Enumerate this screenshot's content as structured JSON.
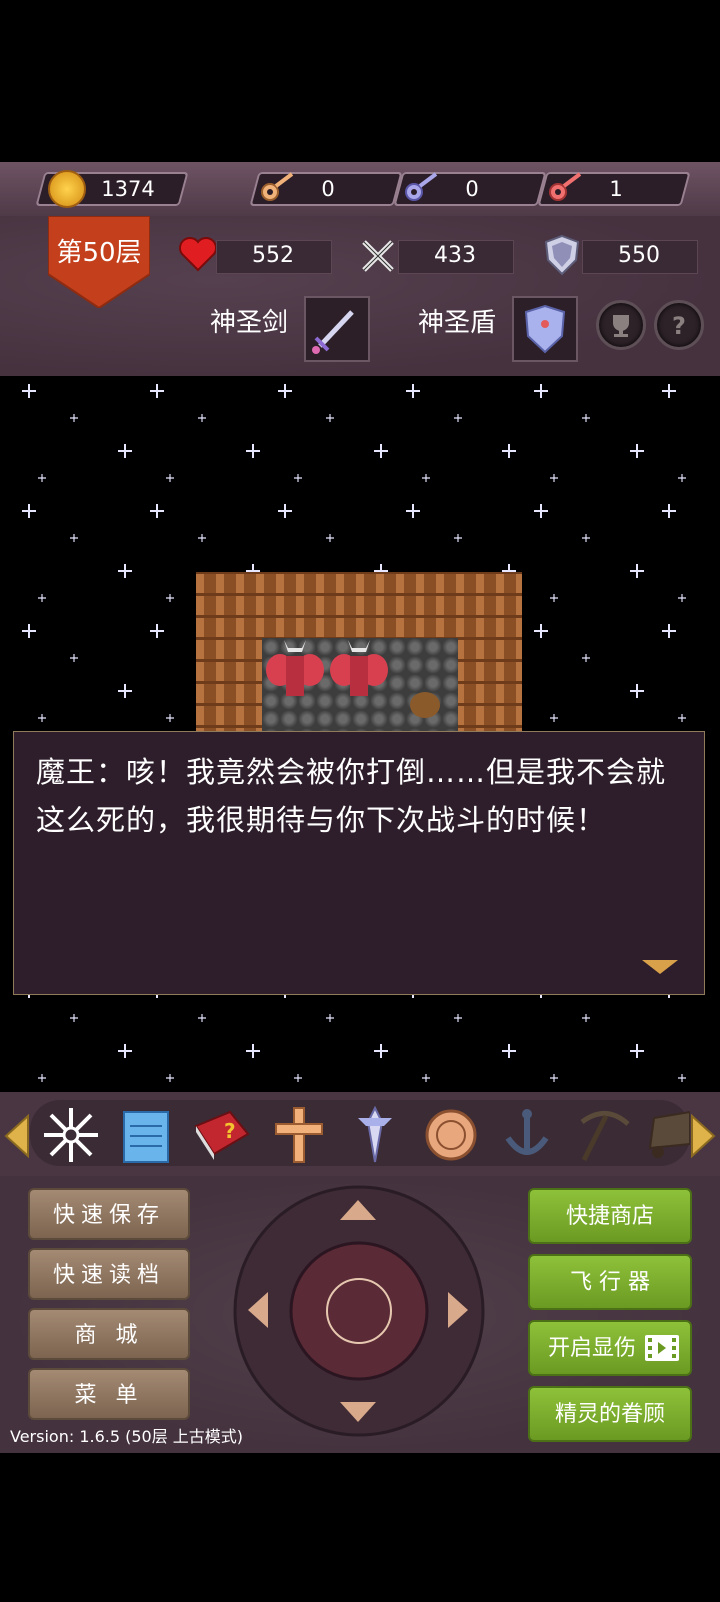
{
  "resources": {
    "gold": "1374",
    "yellow_keys": "0",
    "blue_keys": "0",
    "red_keys": "1"
  },
  "floor": {
    "label": "第50层"
  },
  "stats": {
    "hp": "552",
    "attack": "433",
    "defense": "550"
  },
  "equipment": {
    "weapon_label": "神圣剑",
    "armor_label": "神圣盾"
  },
  "dialog": {
    "text": "魔王：咳！我竟然会被你打倒……但是我不会就这么死的，我很期待与你下次战斗的时候！"
  },
  "inventory": {
    "items": [
      "snowflake-icon",
      "notepad-icon",
      "monster-book-icon",
      "cross-icon",
      "holy-water-icon",
      "medal-icon",
      "anchor-icon",
      "pickaxe-icon",
      "cart-icon"
    ]
  },
  "buttons": {
    "quick_save": "快速保存",
    "quick_load": "快速读档",
    "shop": "商 城",
    "menu": "菜 单",
    "quick_shop": "快捷商店",
    "flyer": "飞 行 器",
    "show_damage": "开启显伤",
    "fairy_blessing": "精灵的眷顾"
  },
  "version": "Version: 1.6.5 (50层 上古模式)",
  "colors": {
    "panel": "#4a3644",
    "green_button": "#7fb02e",
    "brown_button": "#8f765f",
    "dialog_bg": "#2e1e2b",
    "floor_badge": "#c4401d"
  }
}
